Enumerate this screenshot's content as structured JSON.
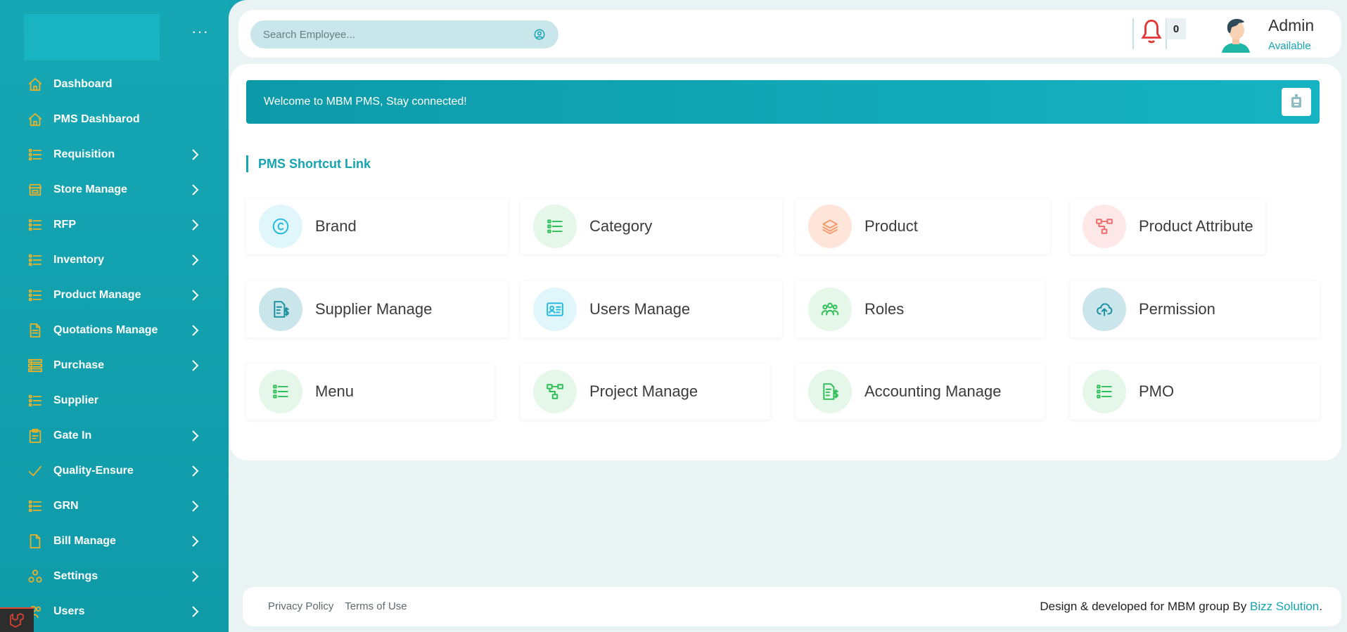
{
  "sidebar": {
    "items": [
      {
        "label": "Dashboard",
        "icon": "home-icon",
        "chevron": false
      },
      {
        "label": "PMS Dashbarod",
        "icon": "home-icon",
        "chevron": false
      },
      {
        "label": "Requisition",
        "icon": "list-icon",
        "chevron": true
      },
      {
        "label": "Store Manage",
        "icon": "store-icon",
        "chevron": true
      },
      {
        "label": "RFP",
        "icon": "list-icon",
        "chevron": true
      },
      {
        "label": "Inventory",
        "icon": "list-icon",
        "chevron": true
      },
      {
        "label": "Product Manage",
        "icon": "list-icon",
        "chevron": true
      },
      {
        "label": "Quotations Manage",
        "icon": "document-icon",
        "chevron": true
      },
      {
        "label": "Purchase",
        "icon": "list-bold-icon",
        "chevron": true
      },
      {
        "label": "Supplier",
        "icon": "list-icon",
        "chevron": false
      },
      {
        "label": "Gate In",
        "icon": "clipboard-icon",
        "chevron": true
      },
      {
        "label": "Quality-Ensure",
        "icon": "check-icon",
        "chevron": true
      },
      {
        "label": "GRN",
        "icon": "list-icon",
        "chevron": true
      },
      {
        "label": "Bill Manage",
        "icon": "file-icon",
        "chevron": true
      },
      {
        "label": "Settings",
        "icon": "settings-icon",
        "chevron": true
      },
      {
        "label": "Users",
        "icon": "users-icon",
        "chevron": true
      }
    ],
    "accent_color": "#f5b323"
  },
  "header": {
    "search_placeholder": "Search Employee...",
    "notification_count": "0",
    "user_name": "Admin",
    "user_status": "Available"
  },
  "welcome_text": "Welcome to MBM PMS, Stay connected!",
  "section_title": "PMS Shortcut Link",
  "shortcuts": [
    {
      "label": "Brand",
      "icon": "copyright-icon",
      "bg": "#e1f6fb",
      "fg": "#22b8dd"
    },
    {
      "label": "Category",
      "icon": "list-icon",
      "bg": "#e4f7e8",
      "fg": "#2dbf57"
    },
    {
      "label": "Product",
      "icon": "layers-icon",
      "bg": "#fde5da",
      "fg": "#f59a6c"
    },
    {
      "label": "Product Attribute",
      "icon": "hierarchy-icon",
      "bg": "#fde7e7",
      "fg": "#ee6b6b"
    },
    {
      "label": "Supplier Manage",
      "icon": "invoice-icon",
      "bg": "#cbe6ea",
      "fg": "#1a8fa0"
    },
    {
      "label": "Users Manage",
      "icon": "id-card-icon",
      "bg": "#e1f6fb",
      "fg": "#22b8dd"
    },
    {
      "label": "Roles",
      "icon": "team-icon",
      "bg": "#e4f7e8",
      "fg": "#2dbf57"
    },
    {
      "label": "Permission",
      "icon": "cloud-upload-icon",
      "bg": "#cbe6ea",
      "fg": "#1a8fa0"
    },
    {
      "label": "Menu",
      "icon": "list-icon",
      "bg": "#e4f7e8",
      "fg": "#2dbf57"
    },
    {
      "label": "Project Manage",
      "icon": "hierarchy-icon",
      "bg": "#e4f7e8",
      "fg": "#2dbf57"
    },
    {
      "label": "Accounting Manage",
      "icon": "invoice-icon",
      "bg": "#e4f7e8",
      "fg": "#2dbf57"
    },
    {
      "label": "PMO",
      "icon": "list-icon",
      "bg": "#e4f7e8",
      "fg": "#2dbf57"
    }
  ],
  "footer": {
    "privacy": "Privacy Policy",
    "terms": "Terms of Use",
    "credit": "Design & developed for MBM group By ",
    "credit_link": "Bizz Solution",
    "credit_end": "."
  }
}
